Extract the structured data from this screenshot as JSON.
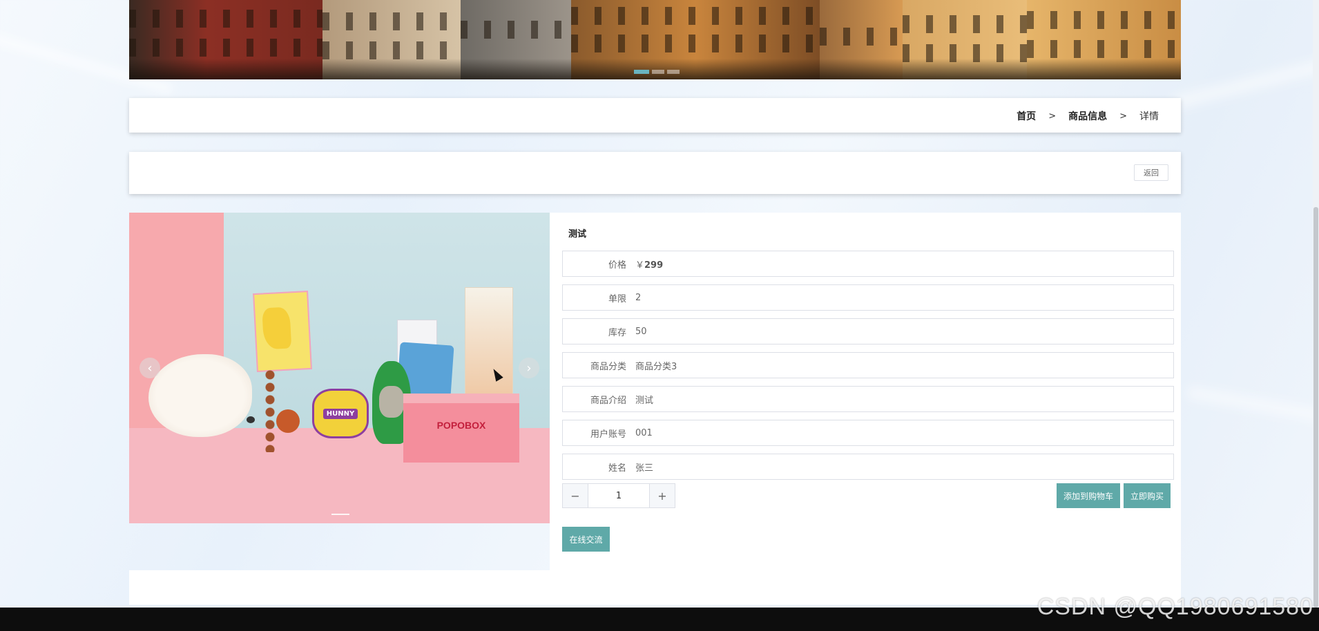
{
  "breadcrumb": {
    "home": "首页",
    "separator": ">",
    "category": "商品信息",
    "current": "详情"
  },
  "back_button": {
    "label": "返回"
  },
  "product": {
    "title": "测试",
    "info": [
      {
        "label": "价格",
        "prefix": "￥",
        "value": "299"
      },
      {
        "label": "单限",
        "value": "2"
      },
      {
        "label": "库存",
        "value": "50"
      },
      {
        "label": "商品分类",
        "value": "商品分类3"
      },
      {
        "label": "商品介绍",
        "value": "测试"
      },
      {
        "label": "用户账号",
        "value": "001"
      },
      {
        "label": "姓名",
        "value": "张三"
      }
    ]
  },
  "quantity": {
    "minus": "−",
    "value": "1",
    "plus": "+"
  },
  "actions": {
    "add_to_cart": "添加到购物车",
    "buy_now": "立即购买",
    "chat": "在线交流"
  },
  "carousel": {
    "prev_icon": "‹",
    "next_icon": "›",
    "box_brand": "POPOBOX",
    "toy_label": "HUNNY"
  },
  "watermark": "CSDN @QQ1980691580",
  "colors": {
    "accent": "#5fa9a8",
    "banner_indicator": "#6ab4c0"
  }
}
